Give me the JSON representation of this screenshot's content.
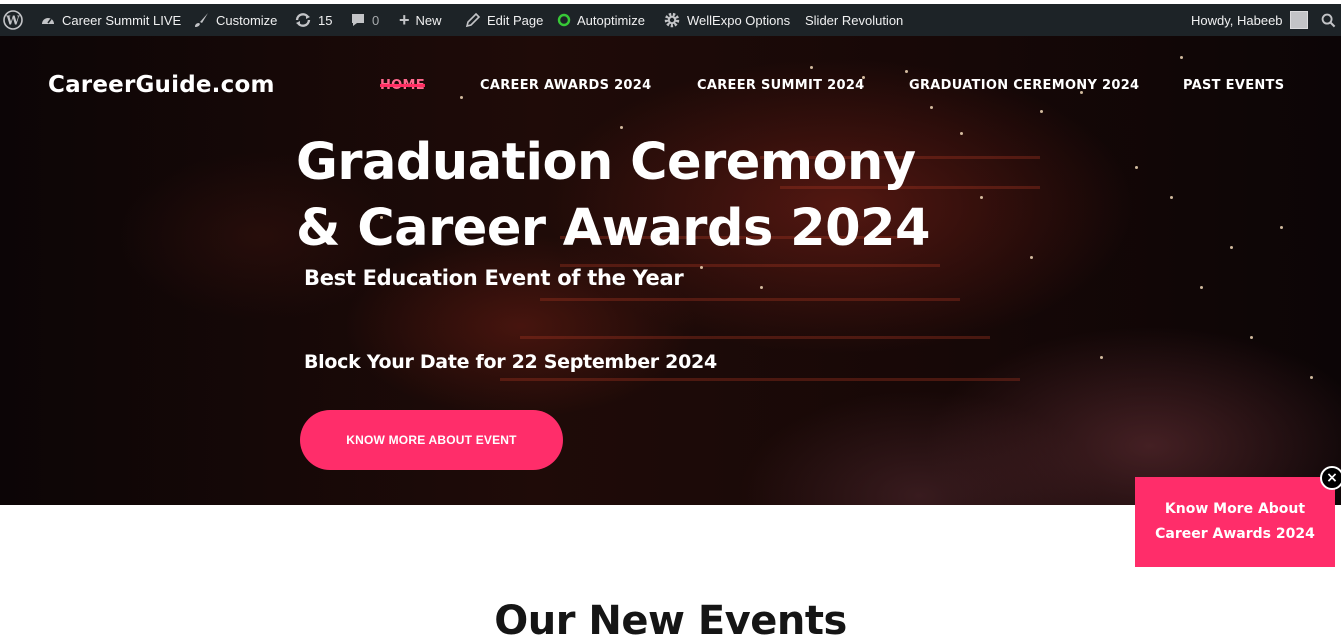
{
  "adminbar": {
    "site_name": "Career Summit LIVE",
    "customize": "Customize",
    "updates_count": "15",
    "comments_count": "0",
    "new": "New",
    "edit_page": "Edit Page",
    "autoptimize": "Autoptimize",
    "wellexpo": "WellExpo Options",
    "slider": "Slider Revolution",
    "howdy": "Howdy, Habeeb"
  },
  "header": {
    "logo": "CareerGuide.com",
    "nav": [
      "HOME",
      "CAREER AWARDS 2024",
      "CAREER SUMMIT 2024",
      "GRADUATION CEREMONY 2024",
      "PAST EVENTS"
    ]
  },
  "hero": {
    "title_line1": "Graduation Ceremony",
    "title_line2": "& Career Awards 2024",
    "subtitle": "Best Education Event of the Year",
    "date_text": "Block Your Date for 22 September 2024",
    "button": "KNOW MORE ABOUT EVENT"
  },
  "popup": {
    "line1": "Know More About",
    "line2": "Career Awards 2024",
    "close": "×"
  },
  "section": {
    "title": "Our New Events"
  },
  "colors": {
    "accent": "#ff2d6a",
    "adminbar": "#1d2327"
  }
}
